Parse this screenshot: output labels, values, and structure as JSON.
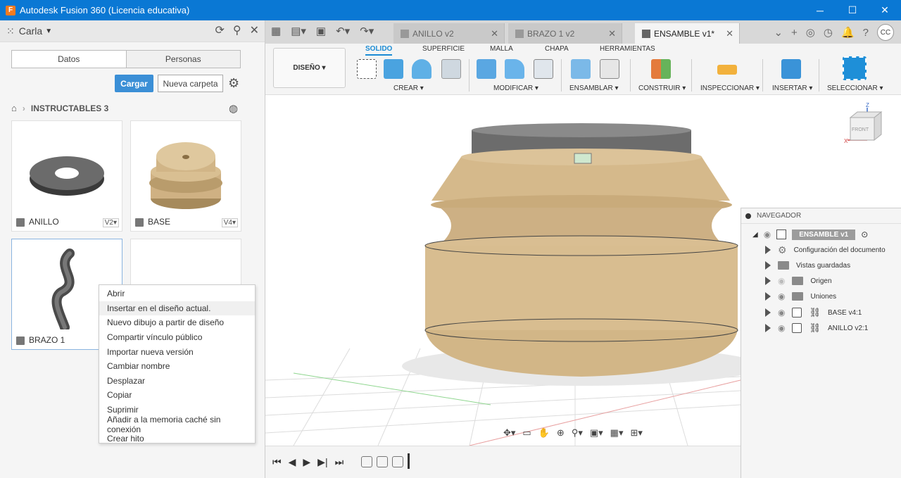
{
  "window": {
    "title": "Autodesk Fusion 360 (Licencia educativa)",
    "app_icon": "F",
    "controls": {
      "minimize": "─",
      "maximize": "☐",
      "close": "✕"
    }
  },
  "data_panel": {
    "user": "Carla",
    "segments": [
      "Datos",
      "Personas"
    ],
    "upload_label": "Cargar",
    "new_folder_label": "Nueva carpeta",
    "breadcrumb": "INSTRUCTABLES 3",
    "files": [
      {
        "name": "ANILLO",
        "version": "V2▾"
      },
      {
        "name": "BASE",
        "version": "V4▾"
      },
      {
        "name": "BRAZO 1",
        "version": ""
      }
    ]
  },
  "context_menu": {
    "items": [
      "Abrir",
      "Insertar en el diseño actual.",
      "Nuevo dibujo a partir de diseño",
      "Compartir vínculo público",
      "Importar nueva versión",
      "Cambiar nombre",
      "Desplazar",
      "Copiar",
      "Suprimir",
      "Añadir a la memoria caché sin conexión",
      "Crear hito"
    ],
    "highlighted_index": 1
  },
  "tabs": [
    {
      "label": "ANILLO v2",
      "active": false
    },
    {
      "label": "BRAZO 1 v2",
      "active": false
    },
    {
      "label": "ENSAMBLE v1*",
      "active": true
    }
  ],
  "tab_close": "✕",
  "account_initials": "CC",
  "toolbar": {
    "workspace": "DISEÑO ▾",
    "ribbon_tabs": [
      "SOLIDO",
      "SUPERFICIE",
      "MALLA",
      "CHAPA",
      "HERRAMIENTAS"
    ],
    "active_tab": "SOLIDO",
    "groups": [
      "CREAR ▾",
      "MODIFICAR ▾",
      "ENSAMBLAR ▾",
      "CONSTRUIR ▾",
      "INSPECCIONAR ▾",
      "INSERTAR ▾",
      "SELECCIONAR ▾"
    ]
  },
  "navigator": {
    "title": "NAVEGADOR",
    "root": "ENSAMBLE v1",
    "items": [
      "Configuración del documento",
      "Vistas guardadas",
      "Origen",
      "Uniones",
      "BASE v4:1",
      "ANILLO v2:1"
    ]
  },
  "viewcube": {
    "axis_z": "Z",
    "axis_x": "X",
    "face": "FRONT"
  },
  "colors": {
    "titlebar": "#0a78d4",
    "accent": "#3b8fd6",
    "model": "#d9bf92"
  }
}
